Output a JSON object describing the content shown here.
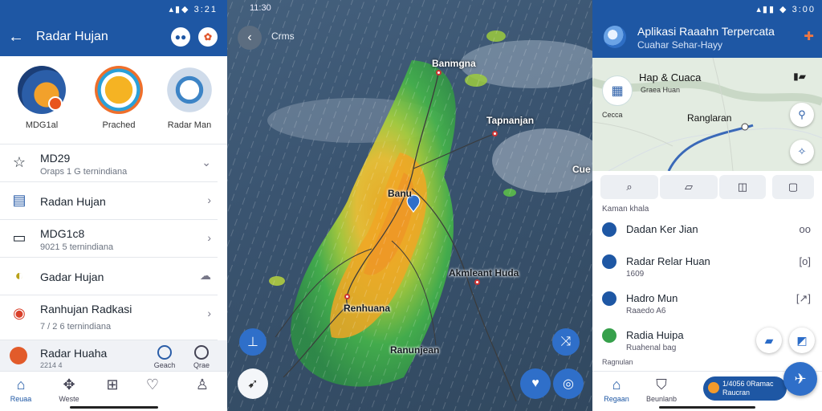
{
  "panel_left": {
    "status_time": "3:21",
    "title": "Radar Hujan",
    "features": [
      {
        "label": "MDG1al",
        "icon": "radar-app-icon"
      },
      {
        "label": "Prached",
        "icon": "forecast-icon"
      },
      {
        "label": "Radar Man",
        "icon": "settings-gear-icon"
      }
    ],
    "list": [
      {
        "title": "MD29",
        "subtitle": "Oraps 1 G ternindiana",
        "icon": "star-icon"
      },
      {
        "title": "Radan Hujan",
        "subtitle": "",
        "icon": "document-icon"
      },
      {
        "title": "MDG1c8",
        "subtitle": "9021 5 ternindiana",
        "icon": "message-icon"
      },
      {
        "title": "Gadar Hujan",
        "subtitle": "",
        "icon": "lemon-icon"
      },
      {
        "title": "Ranhujan Radkasi",
        "subtitle": "7 / 2  6  ternindiana",
        "icon": "location-icon"
      }
    ],
    "highlight": {
      "title": "Radar Huaha",
      "subtitle": "2214 4",
      "mini": [
        {
          "label": "Geach"
        },
        {
          "label": "Qrae"
        }
      ]
    },
    "nav": [
      {
        "label": "Reuaa",
        "icon": "home-icon",
        "active": true
      },
      {
        "label": "Weste",
        "icon": "puzzle-icon"
      },
      {
        "label": "",
        "icon": "plus-box-icon"
      },
      {
        "label": "",
        "icon": "heart-icon"
      },
      {
        "label": "",
        "icon": "profile-icon"
      }
    ]
  },
  "panel_map": {
    "status_time": "11:30",
    "header_label": "Crms",
    "labels": [
      {
        "text": "Banmgna",
        "style": "light"
      },
      {
        "text": "Tapnanjan",
        "style": "light"
      },
      {
        "text": "Cue",
        "style": "light"
      },
      {
        "text": "Banu",
        "style": "dark"
      },
      {
        "text": "Akmleant Huda",
        "style": "dark"
      },
      {
        "text": "Renhuana",
        "style": "dark"
      },
      {
        "text": "Ranunjean",
        "style": "dark"
      }
    ]
  },
  "panel_right": {
    "status_time": "3:00",
    "title": "Aplikasi Raaahn Terpercata",
    "subtitle": "Cuahar Sehar-Hayy",
    "map": {
      "card_title": "Hap & Cuaca",
      "card_sub": "Graea Huan",
      "small_label": "Cecca",
      "city": "Ranglaran"
    },
    "tabs": [
      {
        "icon": "search-icon"
      },
      {
        "icon": "edit-icon"
      },
      {
        "icon": "panel-icon"
      },
      {
        "icon": "chat-icon"
      }
    ],
    "section_label": "Kaman khala",
    "items": [
      {
        "title": "Dadan Ker Jian",
        "subtitle": "",
        "icon_color": "#1e57a4",
        "right": "oo"
      },
      {
        "title": "Radar Relar Huan",
        "subtitle": "1609",
        "icon_color": "#1e57a4",
        "right": "[o]"
      },
      {
        "title": "Hadro Mun",
        "subtitle": "Raaedo A6",
        "icon_color": "#1e57a4",
        "right": "[↗]"
      },
      {
        "title": "Radia Huipa",
        "subtitle": "Ruahenal bag",
        "icon_color": "#36a04b",
        "right": ""
      }
    ],
    "footer_label": "Ragnulan",
    "nav": [
      {
        "label": "Regaan",
        "icon": "home-icon"
      },
      {
        "label": "Beunlanb",
        "icon": "shield-icon"
      }
    ],
    "pill": {
      "line1": "1/4056 0Ramac",
      "line2": "Raucran"
    }
  }
}
